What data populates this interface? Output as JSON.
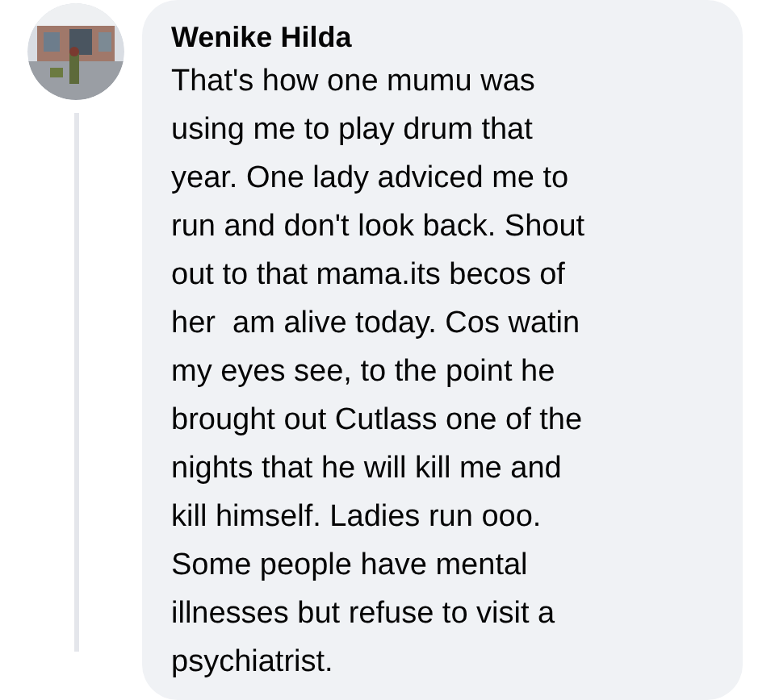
{
  "comment": {
    "author": "Wenike Hilda",
    "text": "That's how one mumu was\nusing me to play drum that\nyear. One lady adviced me to\nrun and don't look back. Shout\nout to that mama.its becos of\nher  am alive today. Cos watin\nmy eyes see, to the point he\nbrought out Cutlass one of the\nnights that he will kill me and\nkill himself. Ladies run ooo.\nSome people have mental\nillnesses but refuse to visit a\npsychiatrist."
  }
}
